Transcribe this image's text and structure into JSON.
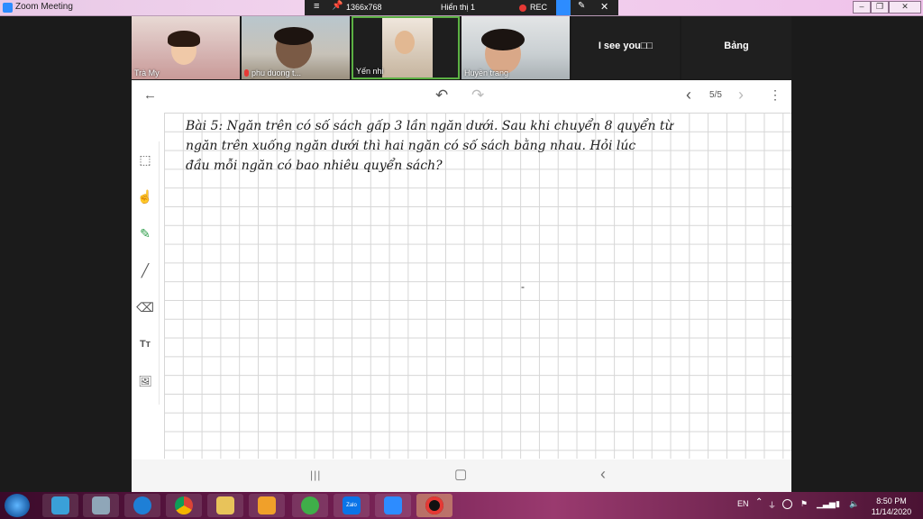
{
  "window": {
    "title": "Zoom Meeting",
    "controls": [
      "–",
      "❐",
      "✕"
    ]
  },
  "share_bar": {
    "menu_icon": "≡",
    "pin_icon": "📌",
    "resolution": "1366x768",
    "view_label": "Hiển thị 1",
    "rec_label": "REC",
    "pen_icon": "✎",
    "close_icon": "✕"
  },
  "participants": [
    {
      "name": "Trà My",
      "muted": false
    },
    {
      "name": "phu duong t...",
      "muted": true
    },
    {
      "name": "Yến nhi",
      "muted": false
    },
    {
      "name": "Huyền trang",
      "muted": false
    },
    {
      "name": "I see you□□",
      "video": false
    },
    {
      "name": "Bảng",
      "video": false
    }
  ],
  "whiteboard": {
    "back_icon": "←",
    "undo_icon": "↶",
    "redo_icon": "↷",
    "prev_icon": "‹",
    "next_icon": "›",
    "page_indicator": "5/5",
    "more_icon": "⋮",
    "tools": [
      "select-icon",
      "hand-icon",
      "pen-icon",
      "line-icon",
      "eraser-icon",
      "text-icon",
      "image-icon"
    ],
    "tool_glyphs": [
      "⬚",
      "☝",
      "✎",
      "╱",
      "⌫",
      "Tт",
      "🖼"
    ],
    "handwriting": [
      "Bài 5: Ngăn trên có số sách gấp 3 lần ngăn dưới. Sau khi chuyển 8 quyển từ",
      "ngăn trên xuống ngăn dưới thì hai ngăn có số sách bằng nhau. Hỏi lúc",
      "đầu mỗi ngăn có bao nhiêu quyển sách?"
    ],
    "stray_mark": "-"
  },
  "android_nav": {
    "recents_icon": "|||",
    "home_icon": "▢",
    "back_icon": "‹"
  },
  "taskbar": {
    "apps": [
      "windows-explorer",
      "internet-explorer",
      "chrome",
      "file-explorer",
      "media-player",
      "ccleaner",
      "zalo",
      "zoom",
      "recorder"
    ],
    "zalo_label": "Zalo",
    "language": "EN",
    "time": "8:50 PM",
    "date": "11/14/2020"
  },
  "colors": {
    "title_bar": "#efc9ec",
    "share_bar": "#232323",
    "rec": "#e53935",
    "zoom_blue": "#2d8cff",
    "pen_green": "#2e9e4a",
    "active_tile_border": "#5bb043"
  }
}
